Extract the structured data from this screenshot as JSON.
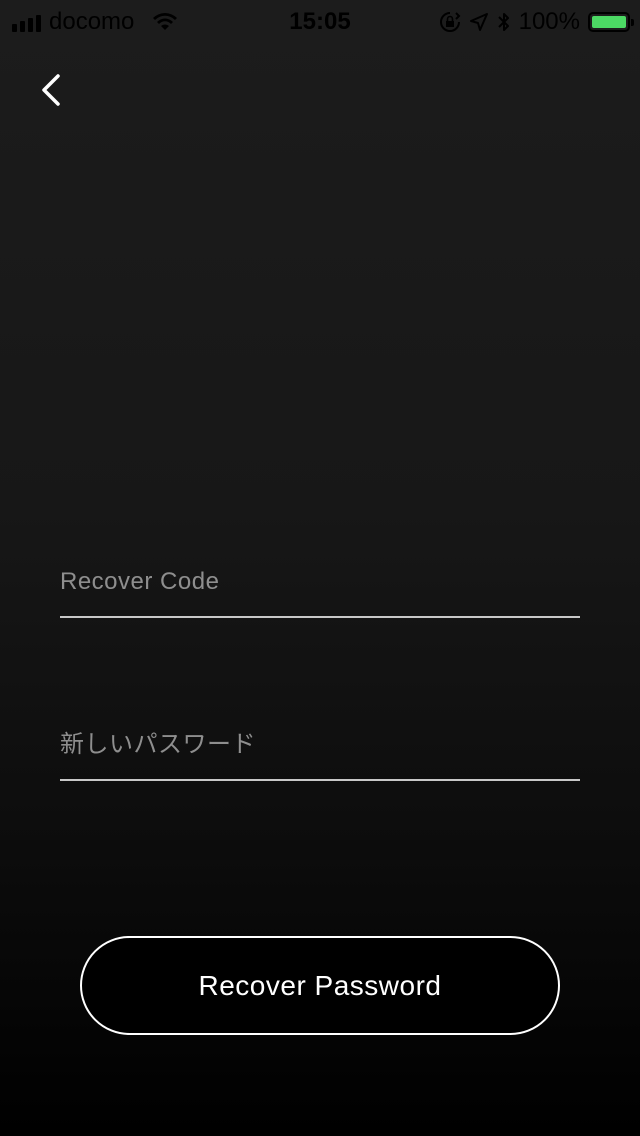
{
  "status_bar": {
    "carrier": "docomo",
    "time": "15:05",
    "battery_percent": "100%",
    "battery_level": 1.0,
    "battery_color": "#4cd964"
  },
  "nav": {
    "back_icon": "chevron-left-icon"
  },
  "form": {
    "recover_code": {
      "value": "",
      "placeholder": "Recover Code"
    },
    "new_password": {
      "value": "",
      "placeholder": "新しいパスワード"
    },
    "submit_label": "Recover Password"
  },
  "colors": {
    "background_top": "#1c1c1c",
    "background_bottom": "#000000",
    "text": "#ffffff",
    "placeholder": "#8e8e8e",
    "underline": "#c8c8c8"
  }
}
